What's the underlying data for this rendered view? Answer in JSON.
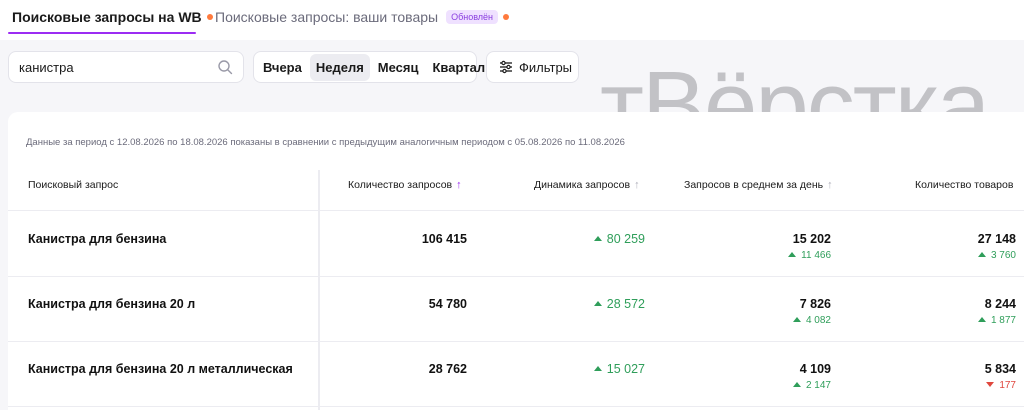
{
  "tabs": [
    {
      "label": "Поисковые запросы на WB"
    },
    {
      "label": "Поисковые запросы: ваши товары",
      "badge": "Обновлён"
    }
  ],
  "search": {
    "value": "канистра"
  },
  "period_buttons": [
    {
      "label": "Вчера"
    },
    {
      "label": "Неделя"
    },
    {
      "label": "Месяц"
    },
    {
      "label": "Квартал"
    }
  ],
  "filters_label": "Фильтры",
  "watermark": "тВёрстка",
  "period_note": "Данные за период с 12.08.2026 по 18.08.2026 показаны в сравнении с предыдущим аналогичным периодом с 05.08.2026 по 11.08.2026",
  "columns": [
    {
      "label": "Поисковый запрос"
    },
    {
      "label": "Количество запросов",
      "sort": "↑"
    },
    {
      "label": "Динамика запросов",
      "sort": "↑"
    },
    {
      "label": "Запросов в среднем за день",
      "sort": "↑"
    },
    {
      "label": "Количество товаров"
    }
  ],
  "rows": [
    {
      "query": "Канистра для бензина",
      "count": "106 415",
      "dynamic": "80 259",
      "avg": "15 202",
      "avg_delta": "11 466",
      "avg_dir": "up",
      "products": "27 148",
      "products_delta": "3 760",
      "products_dir": "up"
    },
    {
      "query": "Канистра для бензина 20 л",
      "count": "54 780",
      "dynamic": "28 572",
      "avg": "7 826",
      "avg_delta": "4 082",
      "avg_dir": "up",
      "products": "8 244",
      "products_delta": "1 877",
      "products_dir": "up"
    },
    {
      "query": "Канистра для бензина 20 л металлическая",
      "count": "28 762",
      "dynamic": "15 027",
      "avg": "4 109",
      "avg_delta": "2 147",
      "avg_dir": "up",
      "products": "5 834",
      "products_delta": "177",
      "products_dir": "down"
    }
  ],
  "colors": {
    "accent": "#9c2cf3",
    "positive": "#2f9e5a",
    "negative": "#e0473e",
    "dot": "#ff7a3d"
  }
}
